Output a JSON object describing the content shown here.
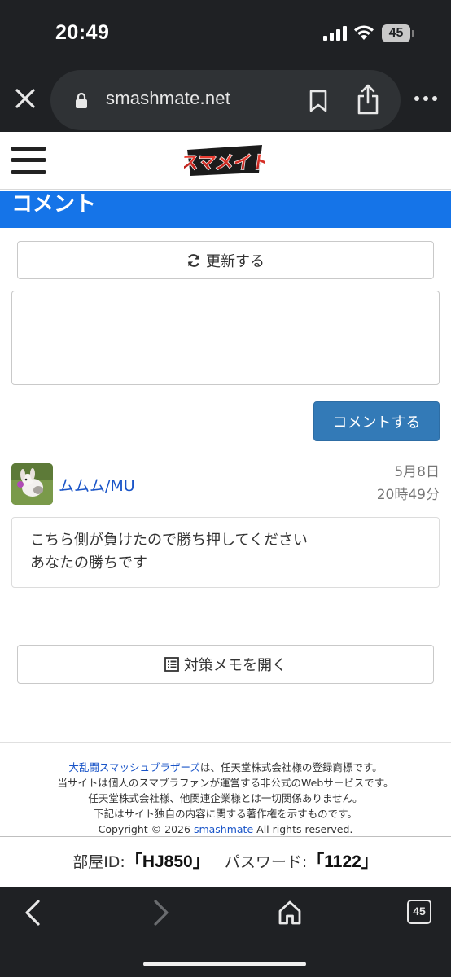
{
  "status_bar": {
    "time": "20:49",
    "battery": "45"
  },
  "browser": {
    "url": "smashmate.net",
    "tab_count": "45"
  },
  "site": {
    "logo_text": "スマメイト",
    "section_title": "コメント"
  },
  "main": {
    "refresh_label": "更新する",
    "submit_label": "コメントする",
    "comment_input_value": "",
    "memo_label": "対策メモを開く"
  },
  "comments": [
    {
      "user": "ムムム/MU",
      "date": "5月8日",
      "time": "20時49分",
      "lines": [
        "こちら側が負けたので勝ち押してください",
        "あなたの勝ちです"
      ]
    }
  ],
  "footer": {
    "game_link": "大乱闘スマッシュブラザーズ",
    "line1_rest": "は、任天堂株式会社様の登録商標です。",
    "line2": "当サイトは個人のスマブラファンが運営する非公式のWebサービスです。",
    "line3": "任天堂株式会社様、他関連企業様とは一切関係ありません。",
    "line4": "下記はサイト独自の内容に関する著作権を示すものです。",
    "copyright_prefix": "Copyright © 2026",
    "copyright_link": "smashmate",
    "copyright_suffix": "All rights reserved."
  },
  "room": {
    "id_label": "部屋ID:",
    "id_value": "「HJ850」",
    "password_label": "パスワード:",
    "password_value": "「1122」"
  },
  "colors": {
    "accent_blue": "#1574e8",
    "button_blue": "#337ab7",
    "link_blue": "#1a55c8",
    "chrome_dark": "#1f2124"
  }
}
